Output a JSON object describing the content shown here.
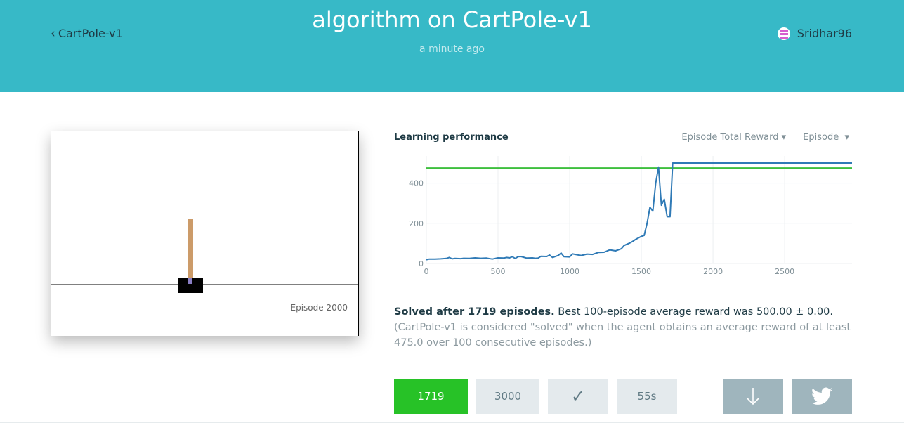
{
  "header": {
    "back_label": "CartPole-v1",
    "title_prefix": "algorithm on",
    "title_env": "CartPole-v1",
    "timeago": "a minute ago",
    "username": "Sridhar96",
    "bg_color": "#37b9c7"
  },
  "video": {
    "episode_label": "Episode 2000"
  },
  "performance": {
    "title": "Learning performance",
    "metric_dropdown": "Episode Total Reward",
    "axis_dropdown": "Episode"
  },
  "chart_data": {
    "type": "line",
    "xlim": [
      0,
      2970
    ],
    "ylim": [
      0,
      500
    ],
    "x_ticks": [
      0,
      500,
      1000,
      1500,
      2000,
      2500
    ],
    "y_ticks": [
      0,
      200,
      400
    ],
    "grid": true,
    "threshold": 475,
    "threshold_color": "#3dbf3d",
    "series_color": "#2f7ab6",
    "series": [
      {
        "x": [
          0,
          20,
          60,
          100,
          140,
          160,
          180,
          200,
          240,
          260,
          300,
          340,
          380,
          420,
          460,
          500,
          540,
          560,
          580,
          600,
          620,
          640,
          660,
          700,
          740,
          760,
          780,
          800,
          840,
          860,
          880,
          920,
          940,
          960,
          1000,
          1020,
          1040,
          1080,
          1120,
          1160,
          1200,
          1240,
          1280,
          1320,
          1360,
          1380,
          1420,
          1440,
          1460,
          1500,
          1520,
          1540,
          1560,
          1580,
          1600,
          1620,
          1640,
          1660,
          1680,
          1700,
          1719,
          1760,
          2000,
          2500,
          2970
        ],
        "y": [
          19,
          22,
          22,
          23,
          25,
          30,
          23,
          25,
          24,
          26,
          25,
          28,
          26,
          27,
          22,
          28,
          27,
          30,
          28,
          34,
          25,
          34,
          35,
          27,
          28,
          26,
          27,
          36,
          35,
          42,
          30,
          40,
          52,
          34,
          33,
          48,
          45,
          40,
          47,
          45,
          55,
          56,
          68,
          63,
          73,
          90,
          102,
          110,
          120,
          135,
          140,
          200,
          280,
          260,
          400,
          480,
          290,
          320,
          233,
          233,
          500,
          500,
          500,
          500,
          500
        ]
      }
    ]
  },
  "solved": {
    "headline": "Solved after 1719 episodes.",
    "best": " Best 100-episode average reward was 500.00 ± 0.00.",
    "note": "(CartPole-v1 is considered \"solved\" when the agent obtains an average reward of at least 475.0 over 100 consecutive episodes.)"
  },
  "stats": {
    "solved_episodes": "1719",
    "total_episodes": "3000",
    "check_symbol": "✓",
    "duration": "55s",
    "accent_green": "#27c227"
  },
  "icons": {
    "download": "download-icon",
    "twitter": "twitter-icon"
  }
}
